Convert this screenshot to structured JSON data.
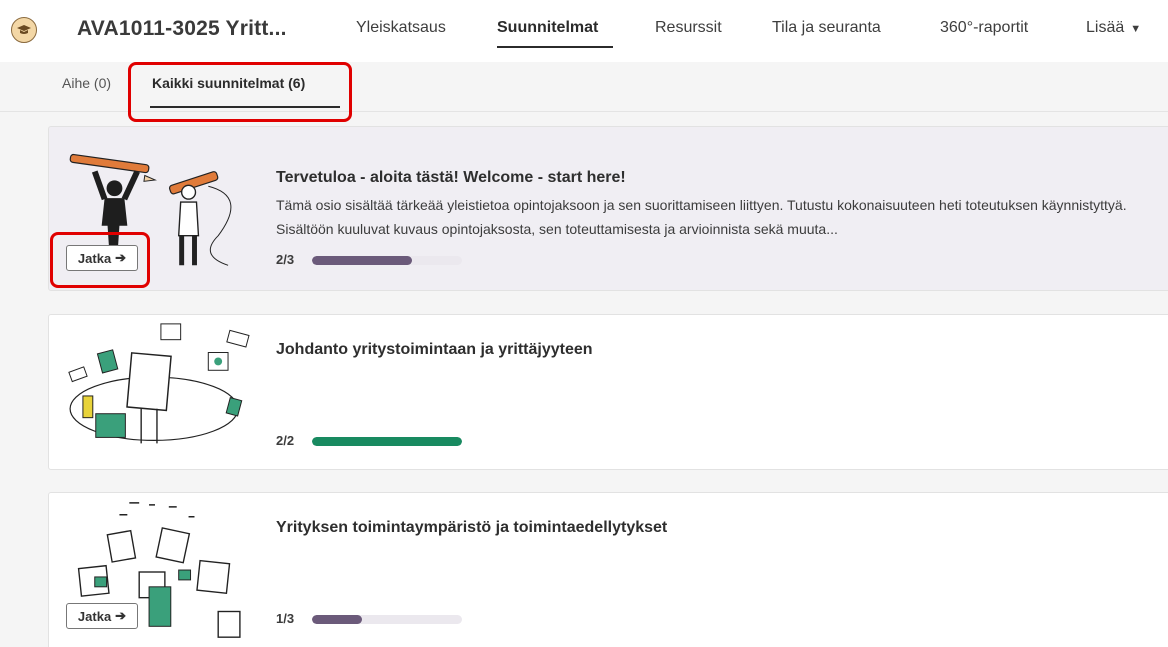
{
  "header": {
    "course_title": "AVA1011-3025 Yritt...",
    "course_icon": "graduation-cap-icon"
  },
  "nav": {
    "items": [
      {
        "label": "Yleiskatsaus",
        "active": false
      },
      {
        "label": "Suunnitelmat",
        "active": true
      },
      {
        "label": "Resurssit",
        "active": false
      },
      {
        "label": "Tila ja seuranta",
        "active": false
      },
      {
        "label": "360°-raportit",
        "active": false
      },
      {
        "label": "Lisää",
        "active": false
      }
    ],
    "more_caret": "▼"
  },
  "subtabs": [
    {
      "label": "Aihe (0)",
      "active": false
    },
    {
      "label": "Kaikki suunnitelmat (6)",
      "active": true
    }
  ],
  "plans": [
    {
      "title": "Tervetuloa - aloita tästä! Welcome - start here!",
      "description": "Tämä osio sisältää tärkeää yleistietoa opintojaksoon ja sen suorittamiseen liittyen. Tutustu kokonaisuuteen heti toteutuksen käynnistyttyä. Sisältöön kuuluvat kuvaus opintojaksosta, sen toteuttamisesta ja arvioinnista sekä muuta...",
      "progress_label": "2/3",
      "progress_fraction": 0.667,
      "progress_color": "#6b5a7a",
      "button_label": "Jatka",
      "highlighted": true
    },
    {
      "title": "Johdanto yritystoimintaan ja yrittäjyyteen",
      "description": "",
      "progress_label": "2/2",
      "progress_fraction": 1.0,
      "progress_color": "#188a60",
      "button_label": "",
      "highlighted": false
    },
    {
      "title": "Yrityksen toimintaympäristö ja toimintaedellytykset",
      "description": "",
      "progress_label": "1/3",
      "progress_fraction": 0.333,
      "progress_color": "#6b5a7a",
      "button_label": "Jatka",
      "highlighted": false
    }
  ],
  "colors": {
    "annotation_red": "#e00000",
    "accent_purple": "#6b5a7a",
    "accent_green": "#188a60"
  }
}
